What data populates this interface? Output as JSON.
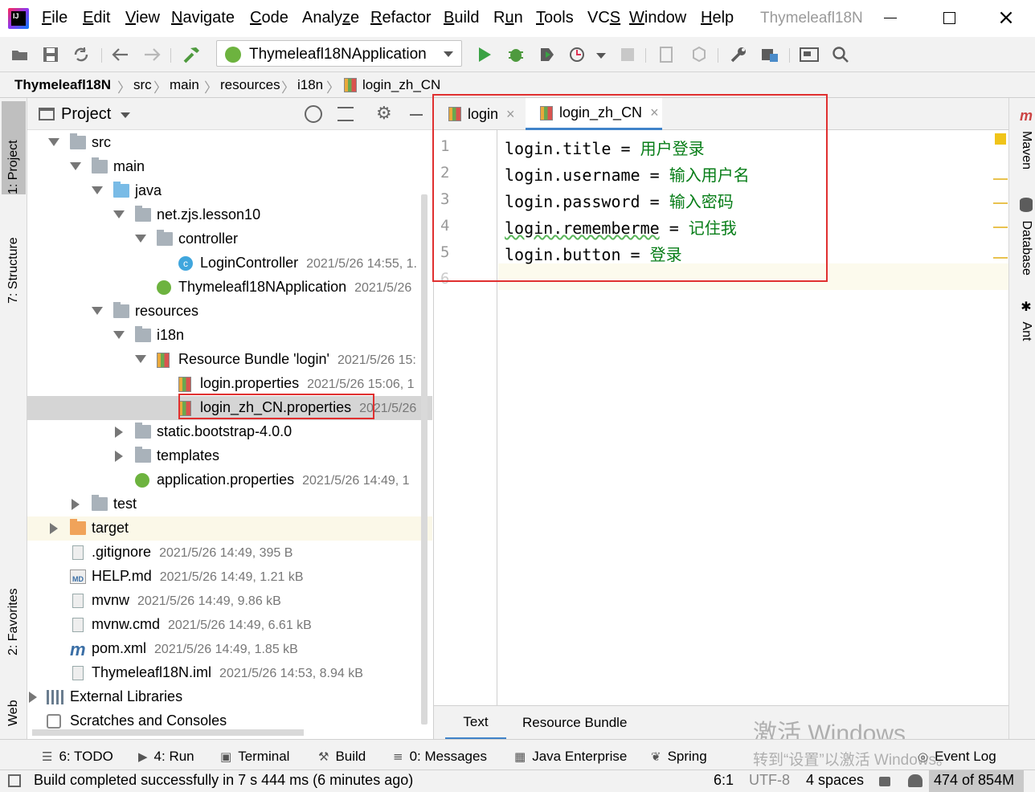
{
  "app": {
    "title": "Thymeleafl18N",
    "logo_text": "IJ",
    "menu": [
      {
        "label": "File",
        "u": "F"
      },
      {
        "label": "Edit",
        "u": "E"
      },
      {
        "label": "View",
        "u": "V"
      },
      {
        "label": "Navigate",
        "u": "N"
      },
      {
        "label": "Code",
        "u": "C"
      },
      {
        "label": "Analyze",
        "u": "z"
      },
      {
        "label": "Refactor",
        "u": "R"
      },
      {
        "label": "Build",
        "u": "B"
      },
      {
        "label": "Run",
        "u": "u"
      },
      {
        "label": "Tools",
        "u": "T"
      },
      {
        "label": "VCS",
        "u": "S"
      },
      {
        "label": "Window",
        "u": "W"
      },
      {
        "label": "Help",
        "u": "H"
      }
    ]
  },
  "toolbar": {
    "run_config": "Thymeleafl18NApplication"
  },
  "breadcrumb": [
    "Thymeleafl18N",
    "src",
    "main",
    "resources",
    "i18n",
    "login_zh_CN"
  ],
  "project_panel": {
    "title": "Project",
    "rows": [
      {
        "label": "src",
        "meta": ""
      },
      {
        "label": "main",
        "meta": ""
      },
      {
        "label": "java",
        "meta": ""
      },
      {
        "label": "net.zjs.lesson10",
        "meta": ""
      },
      {
        "label": "controller",
        "meta": ""
      },
      {
        "label": "LoginController",
        "meta": "2021/5/26 14:55, 1."
      },
      {
        "label": "Thymeleafl18NApplication",
        "meta": "2021/5/26"
      },
      {
        "label": "resources",
        "meta": ""
      },
      {
        "label": "i18n",
        "meta": ""
      },
      {
        "label": "Resource Bundle 'login'",
        "meta": "2021/5/26 15:"
      },
      {
        "label": "login.properties",
        "meta": "2021/5/26 15:06, 1"
      },
      {
        "label": "login_zh_CN.properties",
        "meta": "2021/5/26"
      },
      {
        "label": "static.bootstrap-4.0.0",
        "meta": ""
      },
      {
        "label": "templates",
        "meta": ""
      },
      {
        "label": "application.properties",
        "meta": "2021/5/26 14:49, 1"
      },
      {
        "label": "test",
        "meta": ""
      },
      {
        "label": "target",
        "meta": ""
      },
      {
        "label": ".gitignore",
        "meta": "2021/5/26 14:49, 395 B"
      },
      {
        "label": "HELP.md",
        "meta": "2021/5/26 14:49, 1.21 kB"
      },
      {
        "label": "mvnw",
        "meta": "2021/5/26 14:49, 9.86 kB"
      },
      {
        "label": "mvnw.cmd",
        "meta": "2021/5/26 14:49, 6.61 kB"
      },
      {
        "label": "pom.xml",
        "meta": "2021/5/26 14:49, 1.85 kB"
      },
      {
        "label": "Thymeleafl18N.iml",
        "meta": "2021/5/26 14:53, 8.94 kB"
      },
      {
        "label": "External Libraries",
        "meta": ""
      },
      {
        "label": "Scratches and Consoles",
        "meta": ""
      }
    ]
  },
  "left_tabs": {
    "project": "1: Project",
    "structure": "7: Structure",
    "favorites": "2: Favorites",
    "web": "Web"
  },
  "right_tabs": {
    "maven": "Maven",
    "database": "Database",
    "ant": "Ant"
  },
  "editor": {
    "tabs": [
      {
        "label": "login"
      },
      {
        "label": "login_zh_CN"
      }
    ],
    "lines": [
      {
        "num": "1",
        "key": "login.title",
        "eq": " = ",
        "val": "用户登录"
      },
      {
        "num": "2",
        "key": "login.username",
        "eq": " = ",
        "val": "输入用户名"
      },
      {
        "num": "3",
        "key": "login.password",
        "eq": " = ",
        "val": "输入密码"
      },
      {
        "num": "4",
        "key": "login.rememberme",
        "eq": " = ",
        "val": "记住我"
      },
      {
        "num": "5",
        "key": "login.button",
        "eq": " = ",
        "val": "登录"
      },
      {
        "num": "6",
        "key": "",
        "eq": "",
        "val": ""
      }
    ],
    "bottom_tabs": [
      "Text",
      "Resource Bundle"
    ]
  },
  "watermark": {
    "line1": "激活 Windows",
    "line2": "转到“设置”以激活 Windows。"
  },
  "tool_windows": [
    {
      "label": "6: TODO"
    },
    {
      "label": "4: Run"
    },
    {
      "label": "Terminal"
    },
    {
      "label": "Build"
    },
    {
      "label": "0: Messages"
    },
    {
      "label": "Java Enterprise"
    },
    {
      "label": "Spring"
    },
    {
      "label": "Event Log"
    }
  ],
  "status": {
    "message": "Build completed successfully in 7 s 444 ms (6 minutes ago)",
    "position": "6:1",
    "encoding": "UTF-8",
    "indent": "4 spaces",
    "memory": "474 of 854M"
  }
}
